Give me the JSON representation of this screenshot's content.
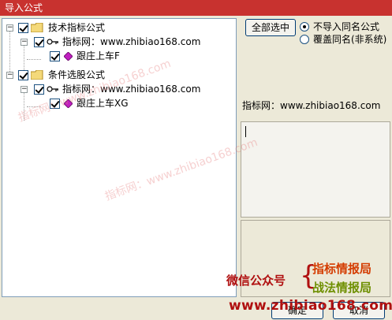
{
  "window": {
    "title": "导入公式"
  },
  "tree": [
    {
      "id": "n0",
      "label": "技术指标公式",
      "kind": "folder",
      "expander": "−"
    },
    {
      "id": "n1",
      "label": "指标网：www.zhibiao168.com",
      "kind": "key",
      "expander": "−"
    },
    {
      "id": "n2",
      "label": "跟庄上车F",
      "kind": "formula"
    },
    {
      "id": "n3",
      "label": "条件选股公式",
      "kind": "folder",
      "expander": "−"
    },
    {
      "id": "n4",
      "label": "指标网：www.zhibiao168.com",
      "kind": "key",
      "expander": "−"
    },
    {
      "id": "n5",
      "label": "跟庄上车XG",
      "kind": "formula"
    }
  ],
  "controls": {
    "select_all_label": "全部选中",
    "radio_skip_label": "不导入同名公式",
    "radio_overwrite_label": "覆盖同名(非系统)",
    "radio_selected": "skip"
  },
  "info": {
    "source_label": "指标网：www.zhibiao168.com"
  },
  "buttons": {
    "ok_label": "确定",
    "cancel_label": "取消"
  },
  "watermark": {
    "text": "指标网：www.zhibiao168.com"
  },
  "promo": {
    "wechat_label": "微信公众号",
    "brand1": "指标情报局",
    "brand2": "战法情报局",
    "site": "www.zhibiao168.com"
  },
  "colors": {
    "titlebar": "#c8322f",
    "promo_red": "#b01010",
    "promo_orange": "#d43c00",
    "promo_green": "#6e8f00"
  }
}
